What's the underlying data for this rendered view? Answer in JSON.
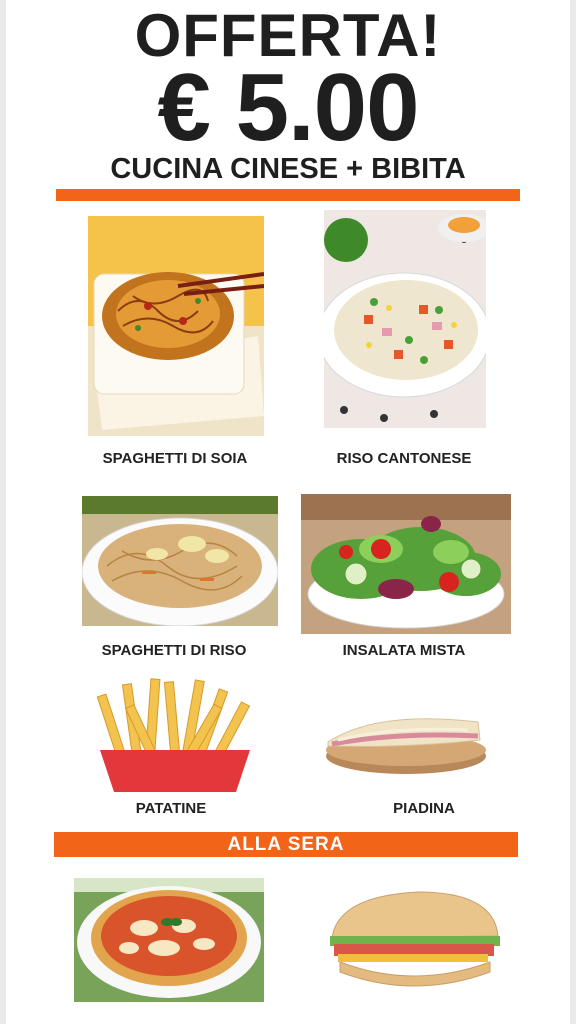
{
  "header": {
    "offer": "OFFERTA!",
    "price": "€ 5.00",
    "subtitle": "CUCINA CINESE + BIBITA"
  },
  "items": [
    {
      "label": "SPAGHETTI DI SOIA"
    },
    {
      "label": "RISO CANTONESE"
    },
    {
      "label": "SPAGHETTI DI RISO"
    },
    {
      "label": "INSALATA MISTA"
    },
    {
      "label": "PATATINE"
    },
    {
      "label": "PIADINA"
    }
  ],
  "evening": {
    "banner": "ALLA  SERA"
  },
  "colors": {
    "accent": "#f26418",
    "text": "#1f1f1f"
  }
}
